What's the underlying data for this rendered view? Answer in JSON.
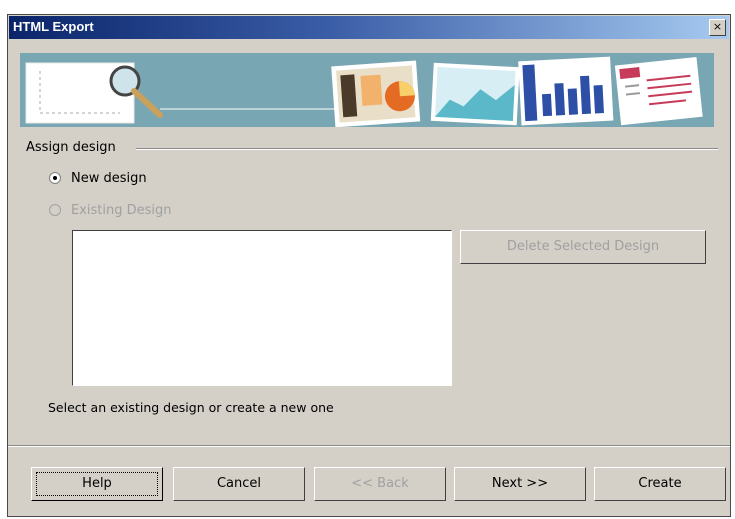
{
  "window": {
    "title": "HTML Export",
    "close_label": "×"
  },
  "assign": {
    "section_label": "Assign design"
  },
  "options": {
    "new_design": "New design",
    "existing_design": "Existing Design"
  },
  "buttons": {
    "delete_selected": "Delete Selected Design",
    "help": "Help",
    "cancel": "Cancel",
    "back": "<< Back",
    "next": "Next >>",
    "create": "Create"
  },
  "hint_text": "Select an existing design or create a new one",
  "state": {
    "selected_option": "new_design",
    "existing_enabled": false
  },
  "colors": {
    "title_start": "#0a246a",
    "title_end": "#a6caf0",
    "dialog_bg": "#d4d0c8",
    "banner_bg": "#6f9fac"
  },
  "icons": [
    "magnifier-icon",
    "close-icon"
  ]
}
